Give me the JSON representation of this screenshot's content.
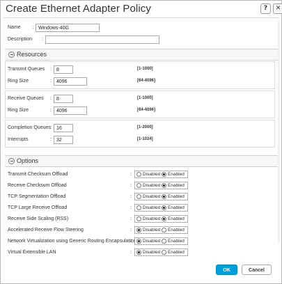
{
  "dialog": {
    "title": "Create Ethernet Adapter Policy",
    "help_label": "?",
    "close_label": "✕"
  },
  "general": {
    "name_label": "Name",
    "name_value": "Windows-40G",
    "description_label": "Description",
    "description_value": ""
  },
  "resources": {
    "title": "Resources",
    "transmit_queues": {
      "label": "Transmit Queues",
      "value": "8",
      "range": "[1-1000]"
    },
    "tx_ring_size": {
      "label": "Ring Size",
      "value": "4096",
      "range": "[64-4096]"
    },
    "receive_queues": {
      "label": "Receive Queues",
      "value": "8",
      "range": "[1-1000]"
    },
    "rx_ring_size": {
      "label": "Ring Size",
      "value": "4096",
      "range": "[64-4096]"
    },
    "completion_queues": {
      "label": "Completion Queues",
      "value": "16",
      "range": "[1-2000]"
    },
    "interrupts": {
      "label": "Interrupts",
      "value": "32",
      "range": "[1-1024]"
    }
  },
  "options": {
    "title": "Options",
    "disabled_label": "Disabled",
    "enabled_label": "Enabled",
    "items": [
      {
        "label": "Transmit Checksum Offload",
        "selected": "Enabled"
      },
      {
        "label": "Receive Checksum Offload",
        "selected": "Enabled"
      },
      {
        "label": "TCP Segmentation Offload",
        "selected": "Enabled"
      },
      {
        "label": "TCP Large Receive Offload",
        "selected": "Enabled"
      },
      {
        "label": "Receive Side Scaling (RSS)",
        "selected": "Enabled"
      },
      {
        "label": "Accelerated Receive Flow Steering",
        "selected": "Disabled"
      },
      {
        "label": "Network Virtualization using Generic Routing Encapsulation",
        "selected": "Disabled"
      },
      {
        "label": "Virtual Extensible LAN",
        "selected": "Disabled"
      }
    ]
  },
  "footer": {
    "ok_label": "OK",
    "cancel_label": "Cancel"
  },
  "colors": {
    "accent": "#049fd9"
  }
}
